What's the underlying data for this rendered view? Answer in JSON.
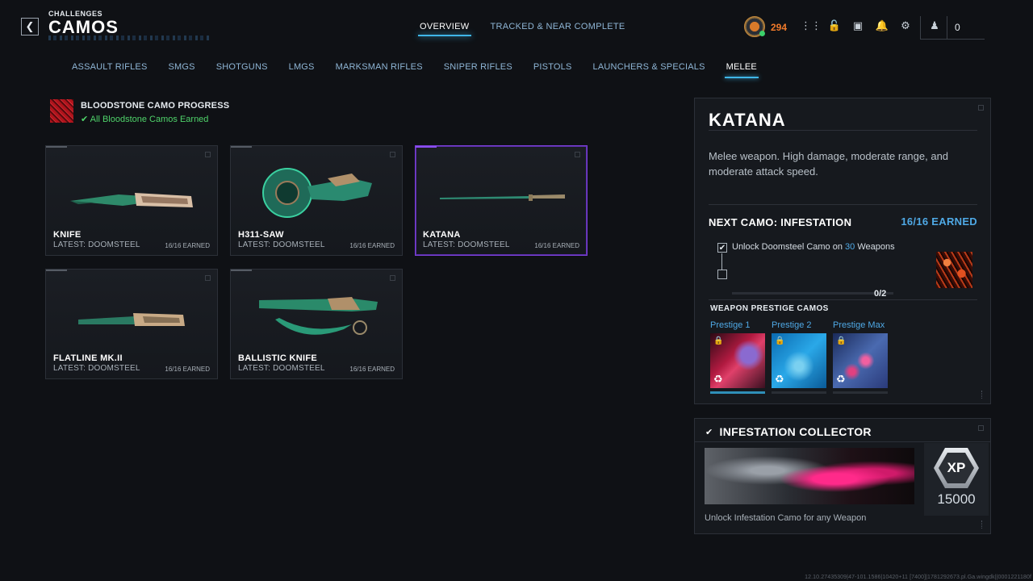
{
  "header": {
    "breadcrumb": "CHALLENGES",
    "title": "CAMOS",
    "tabs": [
      {
        "label": "OVERVIEW",
        "active": true
      },
      {
        "label": "TRACKED & NEAR COMPLETE",
        "active": false
      }
    ]
  },
  "hud": {
    "level": "294",
    "party_count": "0",
    "icons": [
      "level-emblem-icon",
      "grid-menu-icon",
      "unlock-icon",
      "store-icon",
      "bell-icon",
      "gear-icon",
      "party-icon"
    ]
  },
  "categories": [
    {
      "label": "ASSAULT RIFLES",
      "active": false
    },
    {
      "label": "SMGS",
      "active": false
    },
    {
      "label": "SHOTGUNS",
      "active": false
    },
    {
      "label": "LMGS",
      "active": false
    },
    {
      "label": "MARKSMAN RIFLES",
      "active": false
    },
    {
      "label": "SNIPER RIFLES",
      "active": false
    },
    {
      "label": "PISTOLS",
      "active": false
    },
    {
      "label": "LAUNCHERS & SPECIALS",
      "active": false
    },
    {
      "label": "MELEE",
      "active": true
    }
  ],
  "progress": {
    "title": "BLOODSTONE CAMO PROGRESS",
    "status": "All Bloodstone Camos Earned",
    "status_icon": "checkmark-icon",
    "status_color": "#4fd36a"
  },
  "weapons": [
    {
      "name": "KNIFE",
      "latest": "LATEST: DOOMSTEEL",
      "earned": "16/16 EARNED",
      "selected": false
    },
    {
      "name": "H311-SAW",
      "latest": "LATEST: DOOMSTEEL",
      "earned": "16/16 EARNED",
      "selected": false
    },
    {
      "name": "KATANA",
      "latest": "LATEST: DOOMSTEEL",
      "earned": "16/16 EARNED",
      "selected": true
    },
    {
      "name": "FLATLINE MK.II",
      "latest": "LATEST: DOOMSTEEL",
      "earned": "16/16 EARNED",
      "selected": false
    },
    {
      "name": "BALLISTIC KNIFE",
      "latest": "LATEST: DOOMSTEEL",
      "earned": "16/16 EARNED",
      "selected": false
    }
  ],
  "detail": {
    "title": "KATANA",
    "description": "Melee weapon. High damage, moderate range, and moderate attack speed.",
    "next_camo": "NEXT CAMO: INFESTATION",
    "next_earned": "16/16 EARNED",
    "challenge": {
      "text_before": "Unlock Doomsteel Camo on ",
      "highlight": "30",
      "text_after": " Weapons",
      "checked": true,
      "count": "0/2",
      "progress_fraction": 0
    },
    "prestige_title": "WEAPON PRESTIGE CAMOS",
    "prestige": [
      {
        "label": "Prestige 1",
        "locked": true,
        "active": true
      },
      {
        "label": "Prestige 2",
        "locked": true,
        "active": false
      },
      {
        "label": "Prestige Max",
        "locked": true,
        "active": false
      }
    ]
  },
  "collector": {
    "title": "INFESTATION COLLECTOR",
    "xp_badge": "XP",
    "xp_value": "15000",
    "description": "Unlock Infestation Camo for any Weapon"
  },
  "build_info": "12.10.27435309|47-101.1586|10420+11 [7400]|1781292673.pl.Ga.wingdk||0001221180f",
  "colors": {
    "accent_blue": "#3fb6e8",
    "highlight_blue": "#4fa9e6",
    "level_orange": "#f07a2a",
    "selected_purple": "#7a3fd6",
    "success_green": "#4fd36a"
  }
}
